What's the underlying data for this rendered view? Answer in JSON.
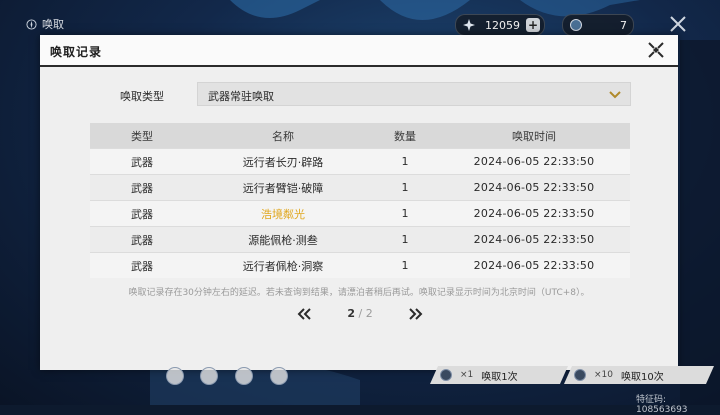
{
  "game_screen": {
    "title": "唤取",
    "currencies": [
      {
        "icon": "lustrous-tide-icon",
        "value": "12059",
        "has_plus": true
      },
      {
        "icon": "radiant-tide-icon",
        "value": "7",
        "has_plus": false
      }
    ]
  },
  "modal": {
    "title": "唤取记录",
    "type_label": "唤取类型",
    "selected_type": "武器常驻唤取",
    "table": {
      "headers": [
        "类型",
        "名称",
        "数量",
        "唤取时间"
      ],
      "rows": [
        {
          "type": "武器",
          "name": "远行者长刃·辟路",
          "qty": "1",
          "time": "2024-06-05 22:33:50",
          "highlight": false
        },
        {
          "type": "武器",
          "name": "远行者臂铠·破障",
          "qty": "1",
          "time": "2024-06-05 22:33:50",
          "highlight": false
        },
        {
          "type": "武器",
          "name": "浩境粼光",
          "qty": "1",
          "time": "2024-06-05 22:33:50",
          "highlight": true
        },
        {
          "type": "武器",
          "name": "源能佩枪·测叁",
          "qty": "1",
          "time": "2024-06-05 22:33:50",
          "highlight": false
        },
        {
          "type": "武器",
          "name": "远行者佩枪·洞察",
          "qty": "1",
          "time": "2024-06-05 22:33:50",
          "highlight": false
        }
      ]
    },
    "notice": "唤取记录存在30分钟左右的延迟。若未查询到结果，请漂泊者稍后再试。唤取记录显示时间为北京时间（UTC+8）。",
    "pager": {
      "current": "2",
      "separator": "/",
      "total": "2"
    }
  },
  "bottom_bar": {
    "pull_once": {
      "count": "×1",
      "label": "唤取1次"
    },
    "pull_ten": {
      "count": "×10",
      "label": "唤取10次"
    },
    "uid": "特征码: 108563693"
  },
  "colors": {
    "highlight_gold": "#e0a61b",
    "modal_bg": "#efefef",
    "header_bg": "#d9d9d9"
  }
}
